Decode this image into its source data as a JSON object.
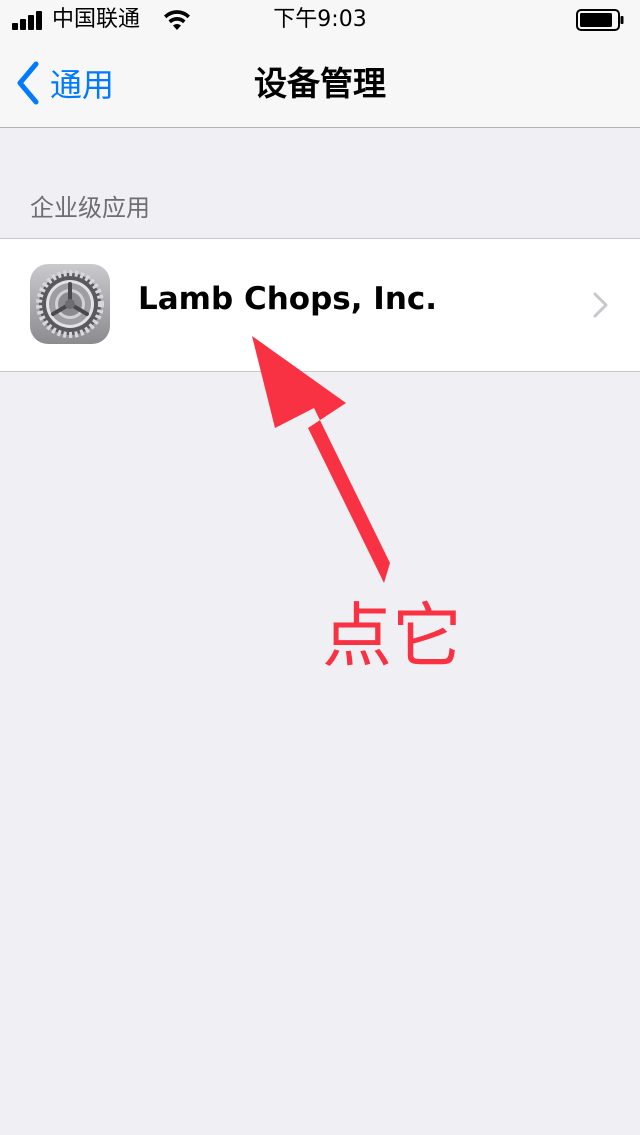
{
  "status_bar": {
    "carrier": "中国联通",
    "time": "下午9:03",
    "icons": [
      "signal-icon",
      "wifi-icon",
      "battery-icon"
    ]
  },
  "nav": {
    "back_label": "通用",
    "title": "设备管理",
    "back_icon": "chevron-left-icon"
  },
  "section": {
    "header": "企业级应用"
  },
  "cell": {
    "label": "Lamb Chops, Inc.",
    "icon": "settings-gear-icon",
    "accessory": "chevron-right-icon"
  },
  "annotation": {
    "text": "点它",
    "color": "#f83143"
  },
  "colors": {
    "accent": "#007aff",
    "background": "#efeff4",
    "header_text": "#6d6d72"
  }
}
